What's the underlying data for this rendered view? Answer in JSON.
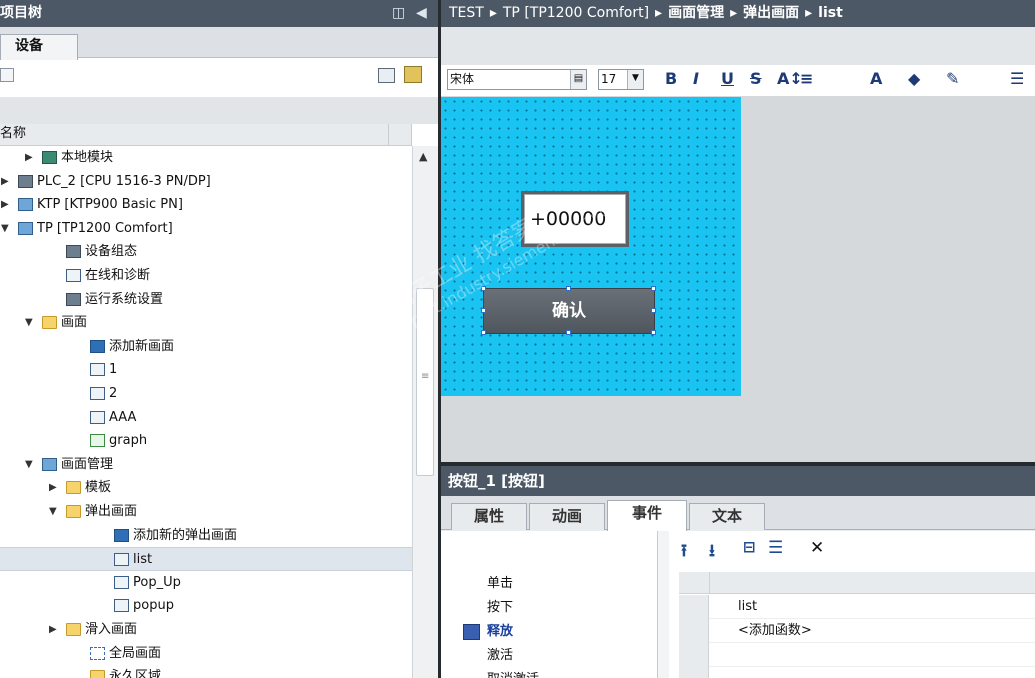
{
  "project_tree": {
    "title": "项目树",
    "panel_controls": [
      "◫",
      "◀"
    ],
    "tab_devices": "设备",
    "column_name": "名称",
    "rows": [
      {
        "label": "本地模块",
        "indent": 2,
        "arrow": "▶",
        "icon": "module-icon"
      },
      {
        "label": "PLC_2 [CPU 1516-3 PN/DP]",
        "indent": 1,
        "arrow": "▶",
        "icon": "plc-icon"
      },
      {
        "label": "KTP [KTP900 Basic PN]",
        "indent": 1,
        "arrow": "▶",
        "icon": "hmi-icon"
      },
      {
        "label": "TP [TP1200 Comfort]",
        "indent": 1,
        "arrow": "▼",
        "icon": "hmi-icon"
      },
      {
        "label": "设备组态",
        "indent": 3,
        "arrow": "",
        "icon": "device-config-icon"
      },
      {
        "label": "在线和诊断",
        "indent": 3,
        "arrow": "",
        "icon": "diagnostics-icon"
      },
      {
        "label": "运行系统设置",
        "indent": 3,
        "arrow": "",
        "icon": "runtime-settings-icon"
      },
      {
        "label": "画面",
        "indent": 2,
        "arrow": "▼",
        "icon": "folder-icon"
      },
      {
        "label": "添加新画面",
        "indent": 4,
        "arrow": "",
        "icon": "add-screen-icon"
      },
      {
        "label": "1",
        "indent": 4,
        "arrow": "",
        "icon": "screen-icon"
      },
      {
        "label": "2",
        "indent": 4,
        "arrow": "",
        "icon": "screen-icon"
      },
      {
        "label": "AAA",
        "indent": 4,
        "arrow": "",
        "icon": "screen-icon"
      },
      {
        "label": "graph",
        "indent": 4,
        "arrow": "",
        "icon": "graph-screen-icon"
      },
      {
        "label": "画面管理",
        "indent": 2,
        "arrow": "▼",
        "icon": "screen-management-icon"
      },
      {
        "label": "模板",
        "indent": 3,
        "arrow": "▶",
        "icon": "template-folder-icon"
      },
      {
        "label": "弹出画面",
        "indent": 3,
        "arrow": "▼",
        "icon": "folder-icon"
      },
      {
        "label": "添加新的弹出画面",
        "indent": 5,
        "arrow": "",
        "icon": "add-screen-icon"
      },
      {
        "label": "list",
        "indent": 5,
        "arrow": "",
        "icon": "screen-icon",
        "selected": true
      },
      {
        "label": "Pop_Up",
        "indent": 5,
        "arrow": "",
        "icon": "screen-icon"
      },
      {
        "label": "popup",
        "indent": 5,
        "arrow": "",
        "icon": "screen-icon"
      },
      {
        "label": "滑入画面",
        "indent": 3,
        "arrow": "▶",
        "icon": "folder-icon"
      },
      {
        "label": "全局画面",
        "indent": 4,
        "arrow": "",
        "icon": "global-screen-icon"
      },
      {
        "label": "永久区域",
        "indent": 4,
        "arrow": "",
        "icon": "folder-icon"
      }
    ]
  },
  "breadcrumb": [
    "TEST",
    "TP [TP1200 Comfort]",
    "画面管理",
    "弹出画面",
    "list"
  ],
  "breadcrumb_sep": "▸",
  "format_toolbar": {
    "font": "宋体",
    "font_size": "17",
    "buttons": [
      "B",
      "I",
      "U",
      "S",
      "A↕",
      "≡",
      "A",
      "◆",
      "✎",
      "☰"
    ]
  },
  "screen": {
    "io_field_value": "+00000",
    "button_label": "确认",
    "watermark_line1": "西门子工业 找答案",
    "watermark_line2": "support.industry.siemens.com/cs"
  },
  "inspector": {
    "title": "按钮_1 [按钮]",
    "tabs": [
      "属性",
      "动画",
      "事件",
      "文本"
    ],
    "active_tab": "事件",
    "events": [
      "单击",
      "按下",
      "释放",
      "激活",
      "取消激活"
    ],
    "active_event": "释放",
    "functions": [
      "list",
      "<添加函数>"
    ]
  }
}
